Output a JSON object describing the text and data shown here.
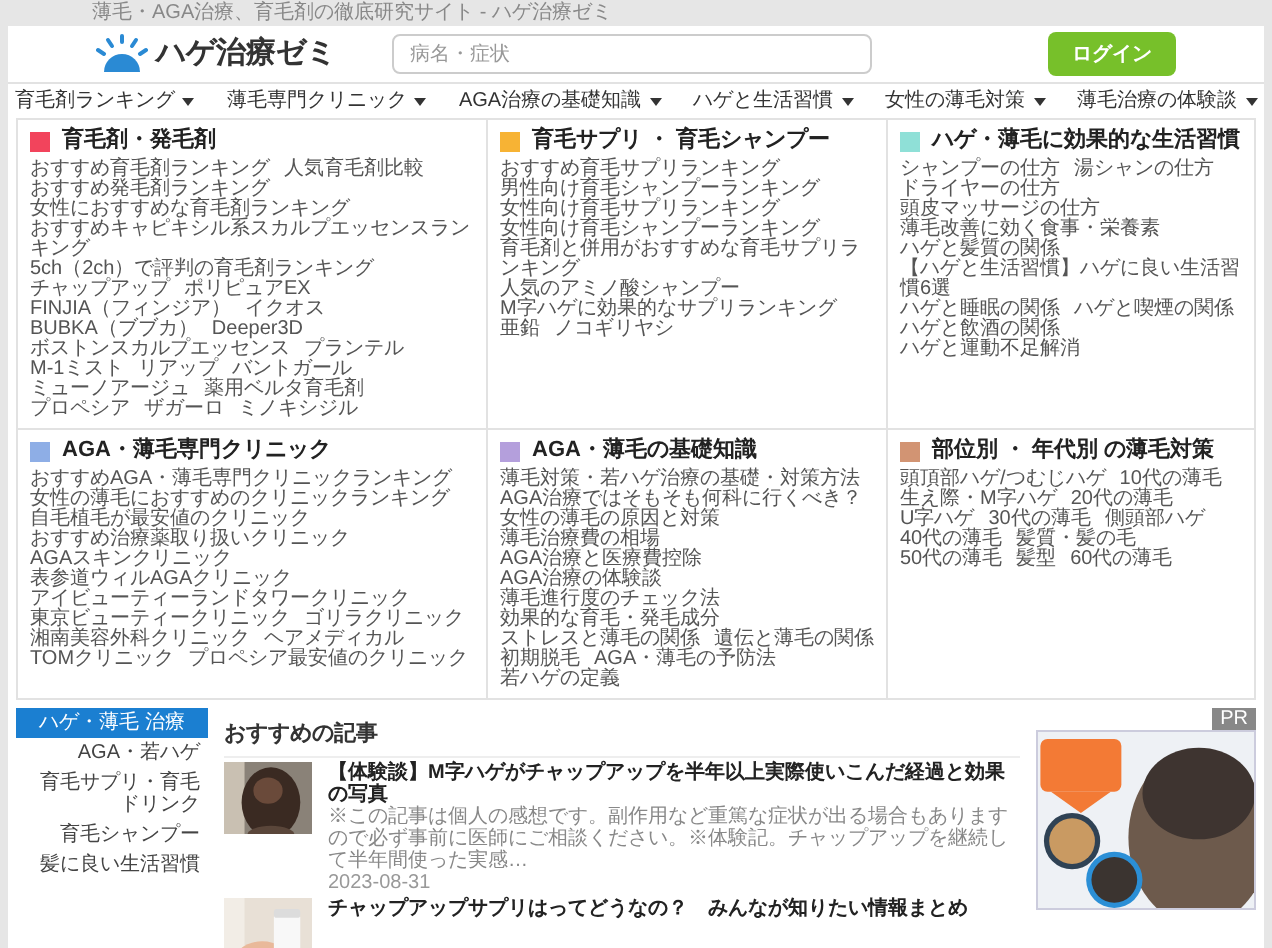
{
  "site_tagline": "薄毛・AGA治療、育毛剤の徹底研究サイト - ハゲ治療ゼミ",
  "logo": "ハゲ治療ゼミ",
  "search": {
    "placeholder": "病名・症状"
  },
  "login_button": "ログイン",
  "nav": [
    "育毛剤ランキング",
    "薄毛専門クリニック",
    "AGA治療の基礎知識",
    "ハゲと生活習慣",
    "女性の薄毛対策",
    "薄毛治療の体験談"
  ],
  "menu_sections": [
    {
      "title": "育毛剤・発毛剤",
      "color": "#f2445c",
      "links": [
        "おすすめ育毛剤ランキング",
        "人気育毛剤比較",
        "おすすめ発毛剤ランキング",
        "女性におすすめな育毛剤ランキング",
        "おすすめキャピキシル系スカルプエッセンスランキング",
        "5ch（2ch）で評判の育毛剤ランキング",
        "チャップアップ",
        "ポリピュアEX",
        "FINJIA（フィンジア）",
        "イクオス",
        "BUBKA（ブブカ）",
        "Deeper3D",
        "ボストンスカルプエッセンス",
        "プランテル",
        "M-1ミスト",
        "リアップ",
        "バントガール",
        "ミューノアージュ",
        "薬用ベルタ育毛剤",
        "プロペシア",
        "ザガーロ",
        "ミノキシジル"
      ]
    },
    {
      "title": "育毛サプリ ・ 育毛シャンプー",
      "color": "#f7b334",
      "links": [
        "おすすめ育毛サプリランキング",
        "男性向け育毛シャンプーランキング",
        "女性向け育毛サプリランキング",
        "女性向け育毛シャンプーランキング",
        "育毛剤と併用がおすすめな育毛サプリランキング",
        "人気のアミノ酸シャンプー",
        "M字ハゲに効果的なサプリランキング",
        "亜鉛",
        "ノコギリヤシ"
      ]
    },
    {
      "title": "ハゲ・薄毛に効果的な生活習慣",
      "color": "#8fe0d7",
      "links": [
        "シャンプーの仕方",
        "湯シャンの仕方",
        "ドライヤーの仕方",
        "頭皮マッサージの仕方",
        "薄毛改善に効く食事・栄養素",
        "ハゲと髪質の関係",
        "【ハゲと生活習慣】ハゲに良い生活習慣6選",
        "ハゲと睡眠の関係",
        "ハゲと喫煙の関係",
        "ハゲと飲酒の関係",
        "ハゲと運動不足解消"
      ]
    },
    {
      "title": "AGA・薄毛専門クリニック",
      "color": "#8eaee6",
      "links": [
        "おすすめAGA・薄毛専門クリニックランキング",
        "女性の薄毛におすすめのクリニックランキング",
        "自毛植毛が最安値のクリニック",
        "おすすめ治療薬取り扱いクリニック",
        "AGAスキンクリニック",
        "表参道ウィルAGAクリニック",
        "アイビューティーランドタワークリニック",
        "東京ビューティークリニック",
        "ゴリラクリニック",
        "湘南美容外科クリニック",
        "ヘアメディカル",
        "TOMクリニック",
        "プロペシア最安値のクリニック"
      ]
    },
    {
      "title": "AGA・薄毛の基礎知識",
      "color": "#b49fdc",
      "links": [
        "薄毛対策・若ハゲ治療の基礎・対策方法",
        "AGA治療ではそもそも何科に行くべき？",
        "女性の薄毛の原因と対策",
        "薄毛治療費の相場",
        "AGA治療と医療費控除",
        "AGA治療の体験談",
        "薄毛進行度のチェック法",
        "効果的な育毛・発毛成分",
        "ストレスと薄毛の関係",
        "遺伝と薄毛の関係",
        "初期脱毛",
        "AGA・薄毛の予防法",
        "若ハゲの定義"
      ]
    },
    {
      "title": "部位別 ・ 年代別 の薄毛対策",
      "color": "#d29473",
      "links": [
        "頭頂部ハゲ/つむじハゲ",
        "10代の薄毛",
        "生え際・M字ハゲ",
        "20代の薄毛",
        "U字ハゲ",
        "30代の薄毛",
        "側頭部ハゲ",
        "40代の薄毛",
        "髪質・髪の毛",
        "50代の薄毛",
        "髪型",
        "60代の薄毛"
      ]
    }
  ],
  "sidebar_tabs": [
    {
      "label": "ハゲ・薄毛 治療",
      "selected": true
    },
    {
      "label": "AGA・若ハゲ",
      "selected": false
    },
    {
      "label": "育毛サプリ・育毛ドリンク",
      "selected": false
    },
    {
      "label": "育毛シャンプー",
      "selected": false
    },
    {
      "label": "髪に良い生活習慣",
      "selected": false
    }
  ],
  "recommended": {
    "heading": "おすすめの記事",
    "articles": [
      {
        "title": "【体験談】M字ハゲがチャップアップを半年以上実際使いこんだ経過と効果の写真",
        "excerpt": "※この記事は個人の感想です。副作用など重篤な症状が出る場合もありますので必ず事前に医師にご相談ください。※体験記。チャップアップを継続して半年間使った実感…",
        "date": "2023-08-31"
      },
      {
        "title": "チャップアップサプリはってどうなの？　みんなが知りたい情報まとめ"
      }
    ]
  },
  "ad": {
    "badge": "PR"
  }
}
